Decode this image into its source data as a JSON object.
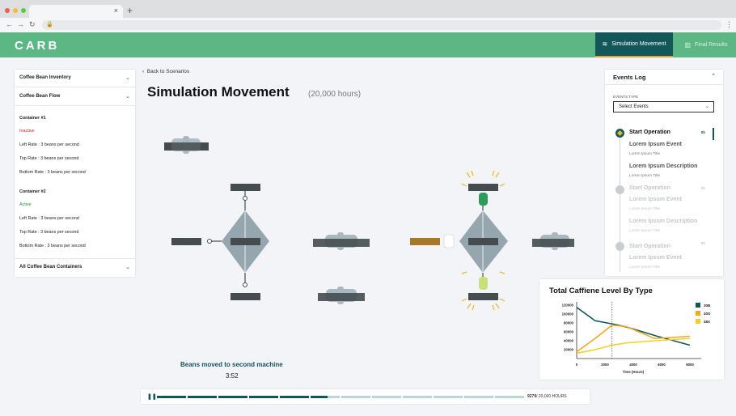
{
  "browser": {
    "new_tab": "+",
    "tab_close": "×"
  },
  "header": {
    "logo": "CARB",
    "tabs": [
      {
        "label": "Simulation Movement",
        "active": true
      },
      {
        "label": "Final Results",
        "active": false
      }
    ]
  },
  "sidebar": {
    "sections": [
      {
        "label": "Coffee Bean Inventory"
      },
      {
        "label": "Coffee Bean Flow"
      },
      {
        "label": "All Coffee Bean Containers"
      }
    ],
    "containers": [
      {
        "name": "Container #1",
        "status": "Inactive",
        "left": "Left Rate : 3 beans per second",
        "top": "Top Rate : 3 beans per second",
        "bottom": "Bottom Rate : 3 beans per second"
      },
      {
        "name": "Container #2",
        "status": "Active",
        "left": "Left Rate : 3 beans per second",
        "top": "Top Rate : 3 beans per second",
        "bottom": "Bottom Rate : 3 beans per second"
      }
    ]
  },
  "main": {
    "back_label": "Back to Scenarios",
    "title": "Simulation Movement",
    "subtitle": "(20,000 hours)",
    "caption": "Beans moved to second machine",
    "time": "3:52"
  },
  "player": {
    "progress_hours": 9279,
    "total_hours": 20000,
    "counter_current": "9279",
    "counter_total": "/ 20,000 HOURS"
  },
  "events_log": {
    "title": "Events Log",
    "type_label": "EVENTS TYPE",
    "select_value": "Select Events",
    "events": [
      {
        "title": "Start Operation",
        "hour": "0h",
        "active": true,
        "items": [
          {
            "name": "Lorem Ipsum Event",
            "sub": "Lorem Ipsum Title"
          },
          {
            "name": "Lorem Ipsum Description",
            "sub": "Lorem Ipsum Title"
          }
        ]
      },
      {
        "title": "Start Operation",
        "hour": "0h",
        "active": false,
        "items": [
          {
            "name": "Lorem Ipsum Event",
            "sub": "Lorem Ipsum Title"
          },
          {
            "name": "Lorem Ipsum Description",
            "sub": "Lorem Ipsum Title"
          }
        ]
      },
      {
        "title": "Start Operation",
        "hour": "0h",
        "active": false,
        "items": [
          {
            "name": "Lorem Ipsum Event",
            "sub": "Lorem Ipsum Title"
          }
        ]
      }
    ]
  },
  "chart_data": {
    "type": "line",
    "title": "Total Caffiene Level By Type",
    "xlabel": "Time (Hours)",
    "ylabel": "",
    "xlim": [
      0,
      8000
    ],
    "ylim": [
      0,
      120000
    ],
    "xticks": [
      "0",
      "2000",
      "4000",
      "6000",
      "8000"
    ],
    "yticks": [
      "120000",
      "100000",
      "80000",
      "60000",
      "40000",
      "20000"
    ],
    "marker_x": 2500,
    "legend_position": "right",
    "series": [
      {
        "name": "30B",
        "color": "#12575a",
        "x": [
          0,
          1300,
          2500,
          3500,
          5700,
          8000
        ],
        "y": [
          115000,
          85000,
          78000,
          71000,
          50000,
          30000
        ]
      },
      {
        "name": "40G",
        "color": "#f5a623",
        "x": [
          0,
          1300,
          2500,
          3500,
          5500,
          8000
        ],
        "y": [
          15000,
          45000,
          75000,
          72000,
          45000,
          50000
        ]
      },
      {
        "name": "48X",
        "color": "#f2d02a",
        "x": [
          0,
          1300,
          2500,
          3500,
          5500,
          8000
        ],
        "y": [
          12000,
          20000,
          30000,
          35000,
          40000,
          45000
        ]
      }
    ]
  }
}
